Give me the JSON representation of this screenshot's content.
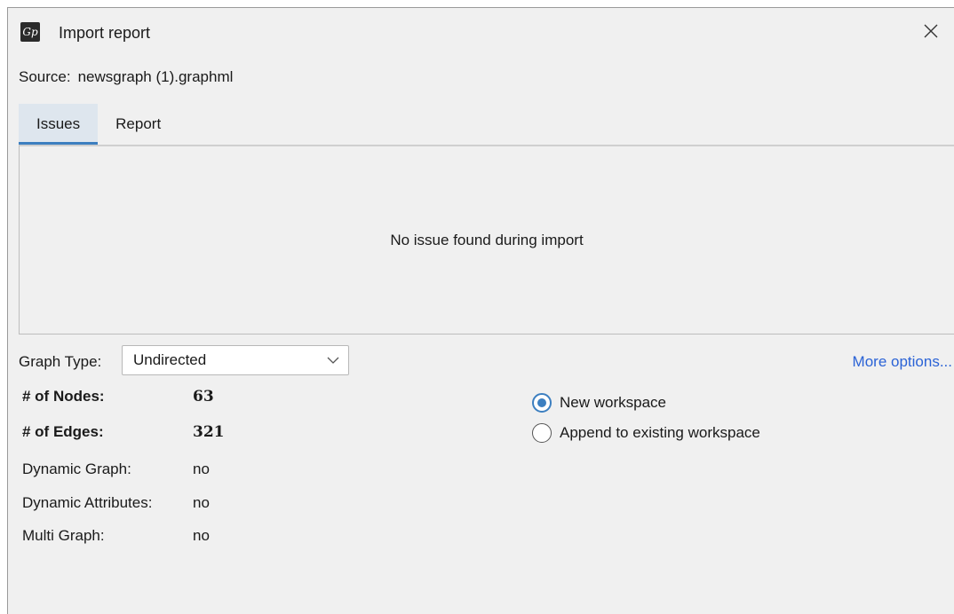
{
  "window": {
    "title": "Import report",
    "app_icon": "gephi-logo-icon",
    "close_icon": "close-icon"
  },
  "source": {
    "label": "Source:",
    "file": "newsgraph (1).graphml"
  },
  "tabs": [
    {
      "label": "Issues",
      "active": true
    },
    {
      "label": "Report",
      "active": false
    }
  ],
  "issues_panel": {
    "message": "No issue found during import"
  },
  "graph_type": {
    "label": "Graph Type:",
    "selected": "Undirected"
  },
  "more_options": "More options...",
  "stats": {
    "nodes": {
      "label": "# of Nodes:",
      "value": "63"
    },
    "edges": {
      "label": "# of Edges:",
      "value": "321"
    },
    "dynamic_graph": {
      "label": "Dynamic Graph:",
      "value": "no"
    },
    "dynamic_attributes": {
      "label": "Dynamic Attributes:",
      "value": "no"
    },
    "multi_graph": {
      "label": "Multi Graph:",
      "value": "no"
    }
  },
  "workspace": {
    "new": {
      "label": "New workspace",
      "checked": true
    },
    "append": {
      "label": "Append to existing workspace",
      "checked": false
    }
  },
  "colors": {
    "accent": "#3c7fc0",
    "link": "#2b63d6",
    "dialog_bg": "#f0f0f0",
    "active_tab_bg": "#dee6ee"
  }
}
